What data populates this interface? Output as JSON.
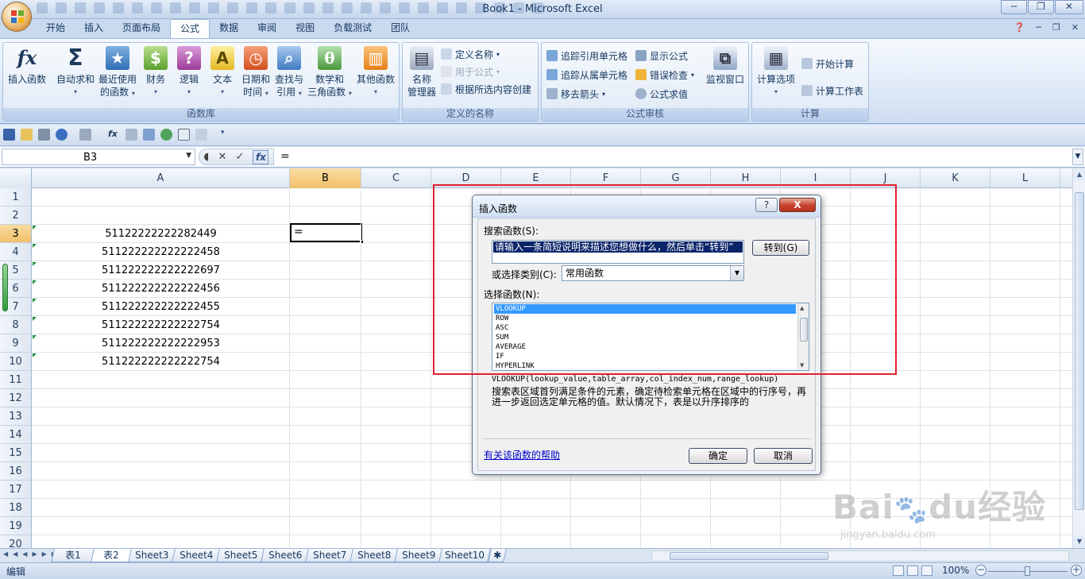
{
  "window": {
    "title": "Book1 - Microsoft Excel"
  },
  "tabs": [
    "开始",
    "插入",
    "页面布局",
    "公式",
    "数据",
    "审阅",
    "视图",
    "负载测试",
    "团队"
  ],
  "active_tab": "公式",
  "ribbon": {
    "groups": {
      "function_library": "函数库",
      "defined_names": "定义的名称",
      "formula_auditing": "公式审核",
      "calculation": "计算"
    },
    "insert_function": "插入函数",
    "autosum": "自动求和",
    "recent_1": "最近使用",
    "recent_2": "的函数",
    "financial": "财务",
    "logical": "逻辑",
    "text": "文本",
    "datetime_1": "日期和",
    "datetime_2": "时间",
    "lookup_1": "查找与",
    "lookup_2": "引用",
    "math_1": "数学和",
    "math_2": "三角函数",
    "more": "其他函数",
    "name_mgr_1": "名称",
    "name_mgr_2": "管理器",
    "define_name": "定义名称",
    "use_in_formula": "用于公式",
    "create_from_sel": "根据所选内容创建",
    "trace_precedents": "追踪引用单元格",
    "trace_dependents": "追踪从属单元格",
    "remove_arrows": "移去箭头",
    "show_formulas": "显示公式",
    "error_checking": "错误检查",
    "evaluate_formula": "公式求值",
    "watch_window": "监视窗口",
    "calc_options": "计算选项",
    "calc_now": "开始计算",
    "calc_sheet": "计算工作表"
  },
  "formula_bar": {
    "name_box": "B3",
    "formula": "="
  },
  "columns": [
    "A",
    "B",
    "C",
    "D",
    "E",
    "F",
    "G",
    "H",
    "I",
    "J",
    "K",
    "L"
  ],
  "active_column": "B",
  "rows": [
    "1",
    "2",
    "3",
    "4",
    "5",
    "6",
    "7",
    "8",
    "9",
    "10",
    "11",
    "12",
    "13",
    "14",
    "15",
    "16",
    "17",
    "18",
    "19",
    "20"
  ],
  "active_row": "3",
  "cells_A": [
    "",
    "",
    "51122222222282449",
    "511222222222222458",
    "511222222222222697",
    "511222222222222456",
    "511222222222222455",
    "511222222222222754",
    "511222222222222953",
    "511222222222222754"
  ],
  "active_cell_value": "=",
  "sheets": [
    "表1",
    "表2",
    "Sheet3",
    "Sheet4",
    "Sheet5",
    "Sheet6",
    "Sheet7",
    "Sheet8",
    "Sheet9",
    "Sheet10"
  ],
  "active_sheet": "表2",
  "status": {
    "mode": "编辑",
    "zoom": "100%"
  },
  "dialog": {
    "title": "插入函数",
    "help_btn": "?",
    "close_btn": "X",
    "search_label": "搜索函数(S):",
    "search_value": "请输入一条简短说明来描述您想做什么，然后单击“转到”",
    "go_button": "转到(G)",
    "category_label": "或选择类别(C):",
    "category_value": "常用函数",
    "list_label": "选择函数(N):",
    "functions": [
      "VLOOKUP",
      "ROW",
      "ASC",
      "SUM",
      "AVERAGE",
      "IF",
      "HYPERLINK"
    ],
    "selected_function": "VLOOKUP",
    "syntax": "VLOOKUP(lookup_value,table_array,col_index_num,range_lookup)",
    "description": "搜索表区域首列满足条件的元素，确定待检索单元格在区域中的行序号，再进一步返回选定单元格的值。默认情况下，表是以升序排序的",
    "help_link": "有关该函数的帮助",
    "ok": "确定",
    "cancel": "取消"
  },
  "watermark": {
    "brand": "Bai",
    "brand2": "du",
    "brand_cn": "经验",
    "url": "jingyan.baidu.com"
  },
  "colors": {
    "accent": "#1e395b",
    "highlight_red": "#e0202e",
    "selection": "#3399ff"
  }
}
